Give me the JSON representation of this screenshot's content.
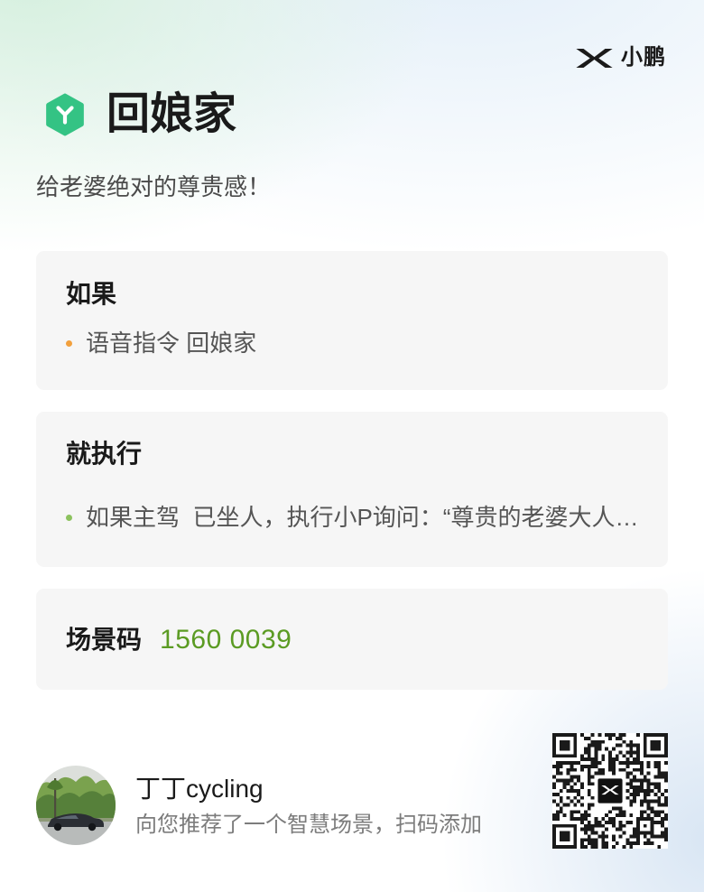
{
  "brand": {
    "logo_icon": "xpeng-logo-icon",
    "name": "小鹏"
  },
  "scene": {
    "icon": "hexagon-y-icon",
    "icon_color": "#34c384",
    "title": "回娘家",
    "subtitle": "给老婆绝对的尊贵感！"
  },
  "trigger_card": {
    "heading": "如果",
    "items": [
      {
        "text": "语音指令 回娘家",
        "dot_color": "#f2a03d"
      }
    ]
  },
  "action_card": {
    "heading": "就执行",
    "items": [
      {
        "text": "如果主驾  已坐人，执行小P询问：“尊贵的老婆大人…",
        "dot_color": "#8cc25e"
      }
    ]
  },
  "code_card": {
    "label": "场景码",
    "value": "1560 0039",
    "value_color": "#5b9b23"
  },
  "sharer": {
    "avatar": "avatar-photo",
    "name": "丁丁cycling",
    "message": "向您推荐了一个智慧场景，扫码添加"
  },
  "qr_code": {
    "icon": "qr-code",
    "center_icon": "xpeng-logo-icon"
  },
  "colors": {
    "card_background": "#f6f6f6",
    "heading_text": "#1a1a1a",
    "body_text": "#555555",
    "accent_green": "#5b9b23"
  }
}
